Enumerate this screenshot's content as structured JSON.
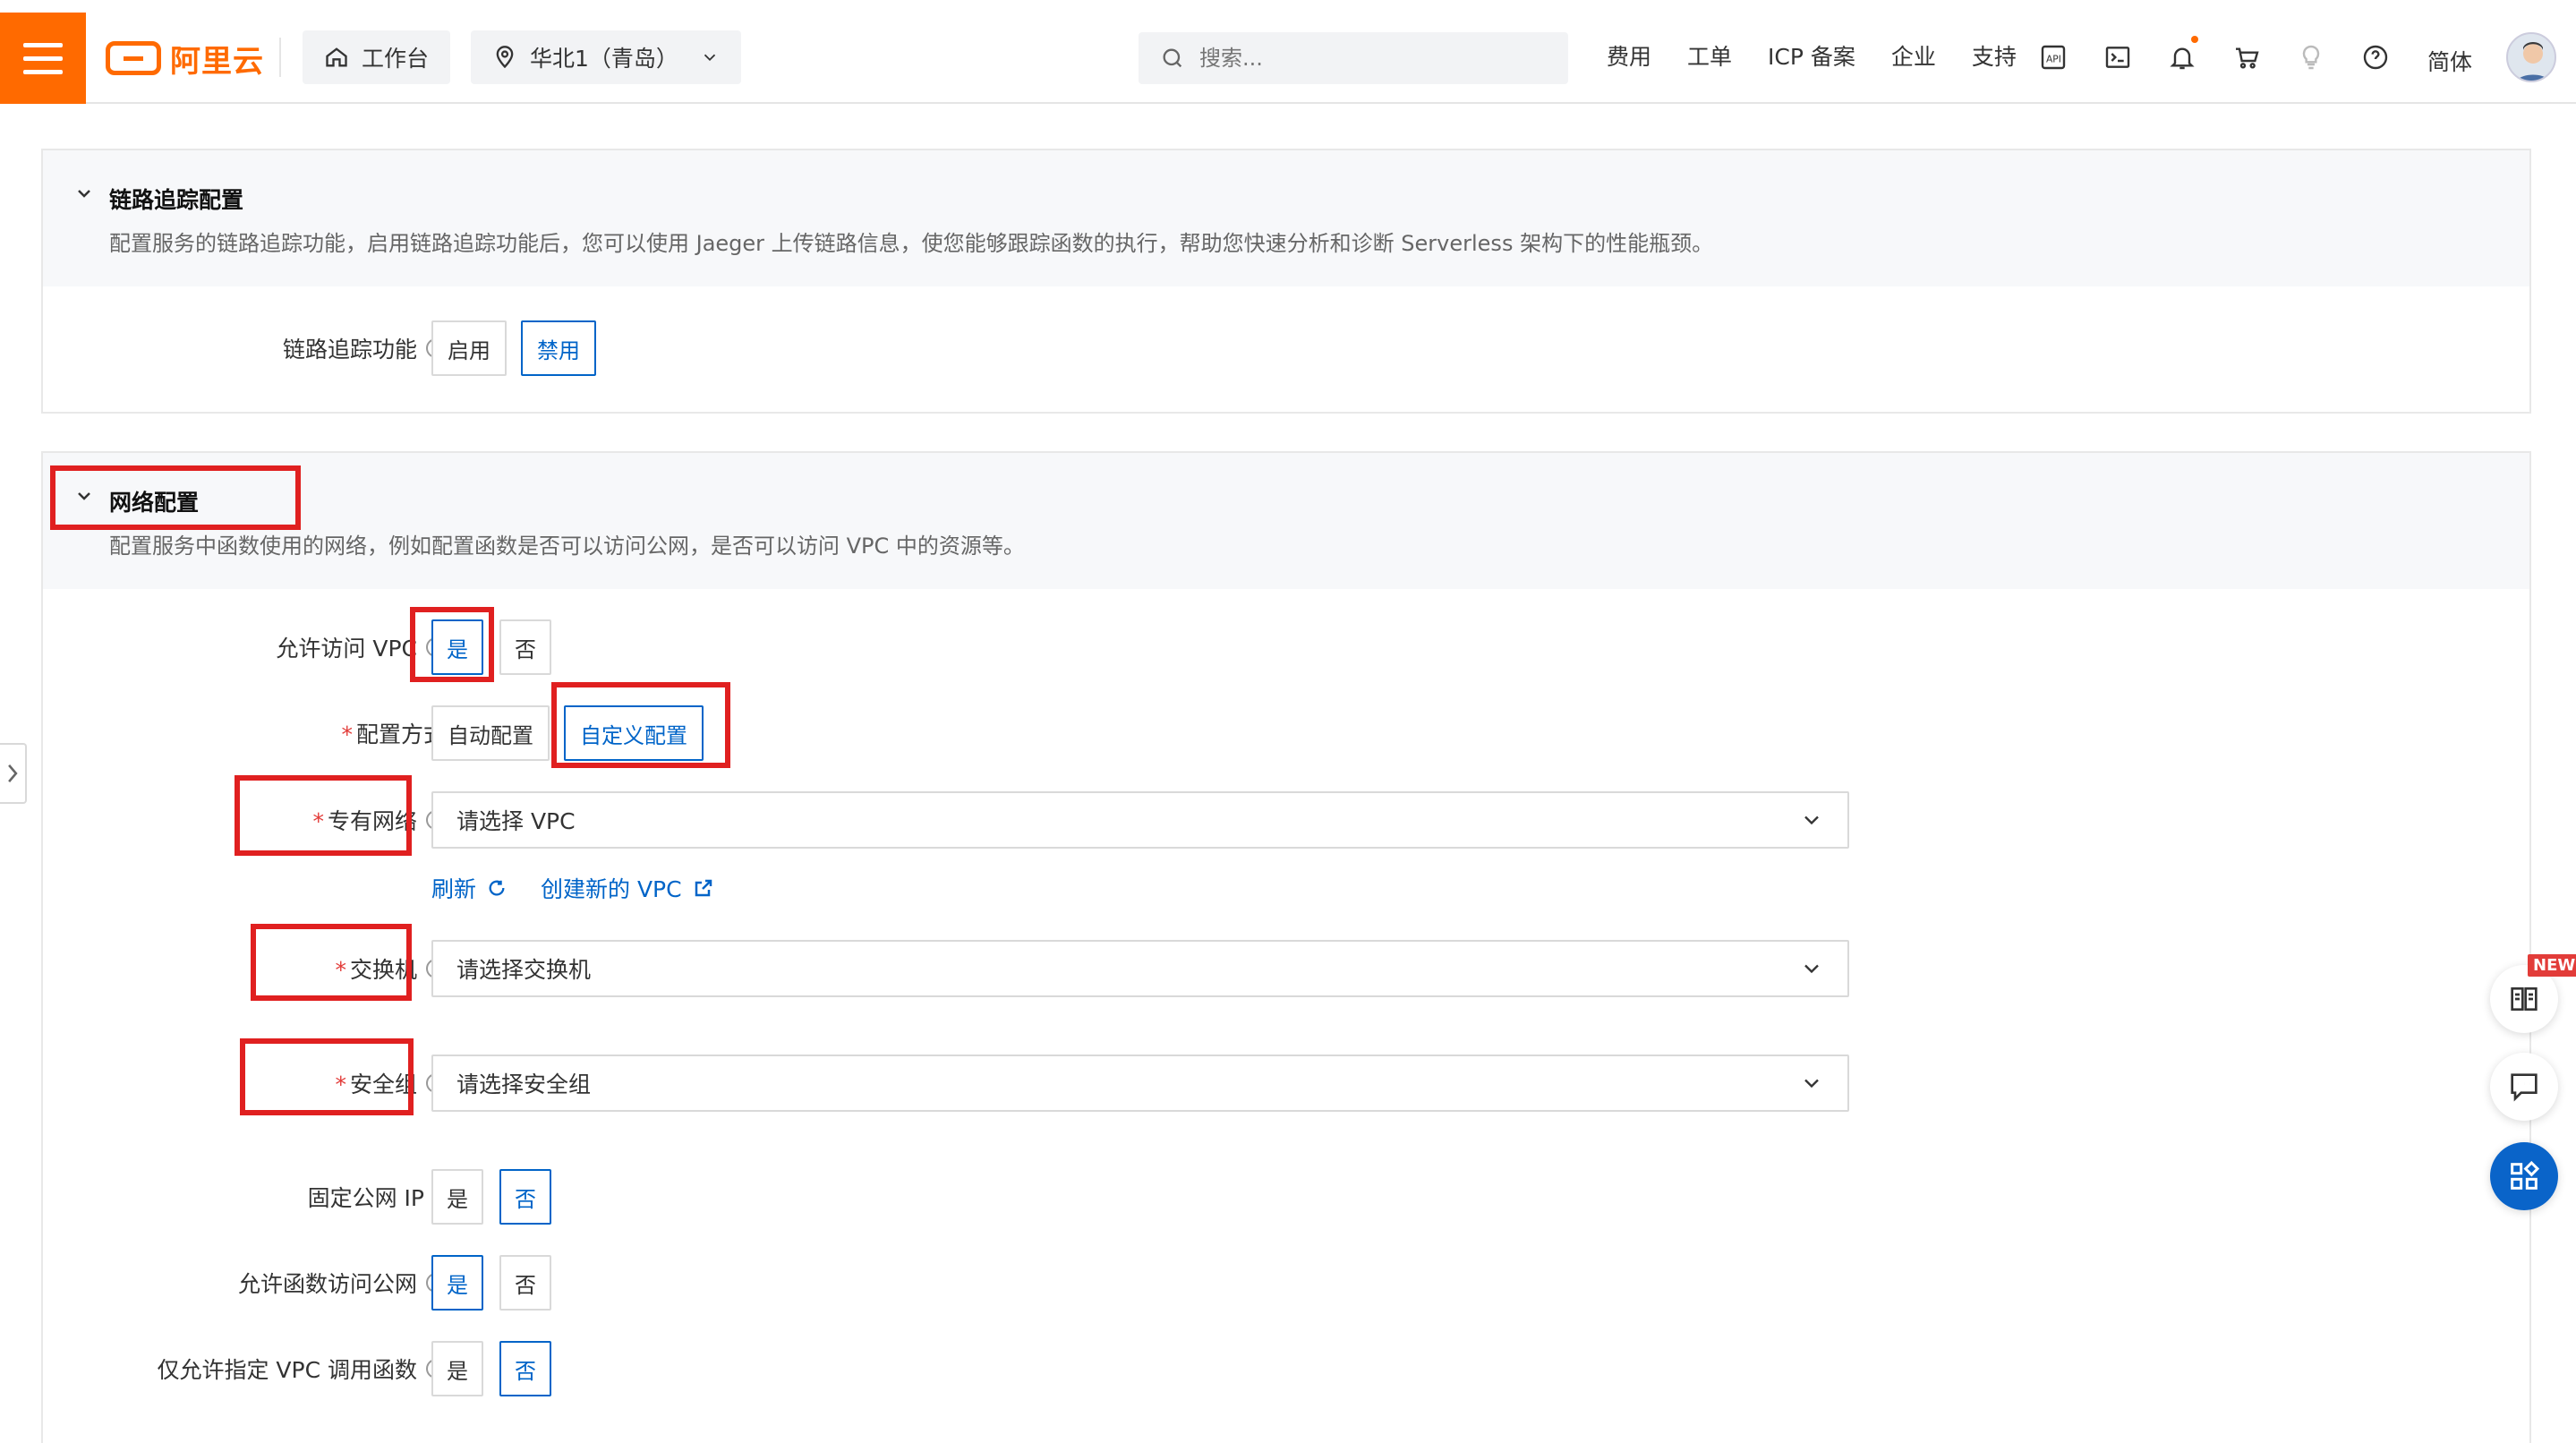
{
  "header": {
    "logo_text": "阿里云",
    "workbench": "工作台",
    "region": "华北1（青岛）",
    "search_placeholder": "搜索...",
    "nav_links": [
      "费用",
      "工单",
      "ICP 备案",
      "企业",
      "支持"
    ],
    "lang": "简体",
    "accent_color": "#ff6a00"
  },
  "tracing": {
    "title": "链路追踪配置",
    "description": "配置服务的链路追踪功能，启用链路追踪功能后，您可以使用 Jaeger 上传链路信息，使您能够跟踪函数的执行，帮助您快速分析和诊断 Serverless 架构下的性能瓶颈。",
    "label": "链路追踪功能",
    "enable": "启用",
    "disable": "禁用"
  },
  "network": {
    "title": "网络配置",
    "description": "配置服务中函数使用的网络，例如配置函数是否可以访问公网，是否可以访问 VPC 中的资源等。",
    "allow_vpc_label": "允许访问 VPC",
    "yes": "是",
    "no": "否",
    "config_mode_label": "配置方式",
    "auto_config": "自动配置",
    "custom_config": "自定义配置",
    "vpc_label": "专有网络",
    "vpc_placeholder": "请选择 VPC",
    "refresh": "刷新",
    "create_vpc": "创建新的 VPC",
    "vswitch_label": "交换机",
    "vswitch_placeholder": "请选择交换机",
    "security_group_label": "安全组",
    "security_group_placeholder": "请选择安全组",
    "fixed_ip_label": "固定公网 IP",
    "internet_label": "允许函数访问公网",
    "only_vpc_label": "仅允许指定 VPC 调用函数"
  },
  "floating": {
    "new_badge": "NEW"
  },
  "colors": {
    "primary": "#0064c8",
    "highlight": "#e02020",
    "required": "#e23c39"
  }
}
